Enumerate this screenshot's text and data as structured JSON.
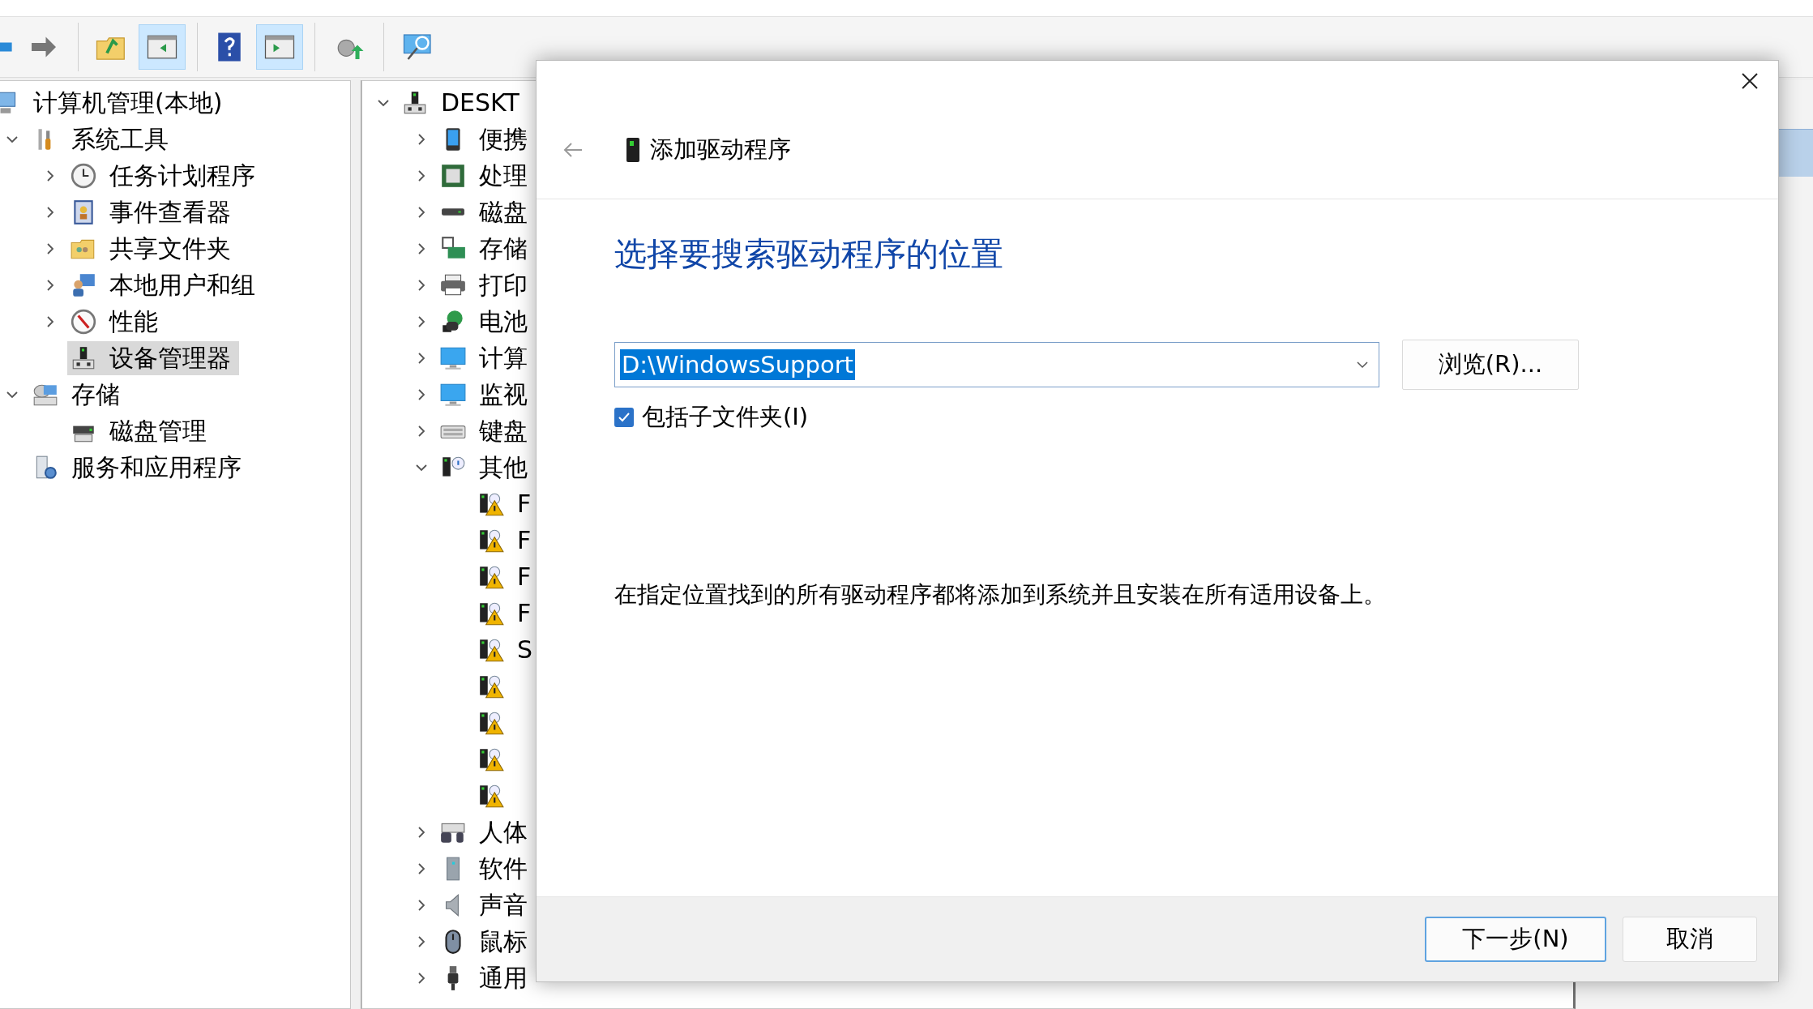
{
  "toolbar": {
    "buttons": [
      {
        "pressed": false
      },
      {
        "pressed": false
      },
      {
        "pressed": false
      },
      {
        "pressed": true
      },
      {
        "pressed": false
      },
      {
        "pressed": true
      },
      {
        "pressed": false
      },
      {
        "pressed": false
      }
    ]
  },
  "console_tree": {
    "items": [
      {
        "label": "计算机管理(本地)",
        "selected": false,
        "children": [
          {
            "label": "系统工具",
            "expanded": true,
            "selected": false,
            "children": [
              {
                "label": "任务计划程序",
                "expanded": false,
                "selected": false
              },
              {
                "label": "事件查看器",
                "expanded": false,
                "selected": false
              },
              {
                "label": "共享文件夹",
                "expanded": false,
                "selected": false
              },
              {
                "label": "本地用户和组",
                "expanded": false,
                "selected": false
              },
              {
                "label": "性能",
                "expanded": false,
                "selected": false
              },
              {
                "label": "设备管理器",
                "selected": true
              }
            ]
          },
          {
            "label": "存储",
            "expanded": true,
            "selected": false,
            "children": [
              {
                "label": "磁盘管理",
                "selected": false
              }
            ]
          },
          {
            "label": "服务和应用程序",
            "selected": false
          }
        ]
      }
    ]
  },
  "device_tree": {
    "items": [
      {
        "label": "DESKT",
        "expanded": true,
        "children": [
          {
            "label": "便携",
            "expanded": false
          },
          {
            "label": "处理",
            "expanded": false
          },
          {
            "label": "磁盘",
            "expanded": false
          },
          {
            "label": "存储",
            "expanded": false
          },
          {
            "label": "打印",
            "expanded": false
          },
          {
            "label": "电池",
            "expanded": false
          },
          {
            "label": "计算",
            "expanded": false
          },
          {
            "label": "监视",
            "expanded": false
          },
          {
            "label": "键盘",
            "expanded": false
          },
          {
            "label": "其他",
            "expanded": true,
            "children": [
              {
                "problem": true,
                "label": "F"
              },
              {
                "problem": true,
                "label": "F"
              },
              {
                "problem": true,
                "label": "F"
              },
              {
                "problem": true,
                "label": "F"
              },
              {
                "problem": true,
                "label": "S"
              },
              {
                "problem": true
              },
              {
                "problem": true
              },
              {
                "problem": true
              },
              {
                "problem": true
              }
            ]
          },
          {
            "label": "人体",
            "expanded": false
          },
          {
            "label": "软件",
            "expanded": false
          },
          {
            "label": "声音",
            "expanded": false
          },
          {
            "label": "鼠标",
            "expanded": false
          },
          {
            "label": "通用",
            "expanded": false
          }
        ]
      }
    ]
  },
  "dialog": {
    "title": "添加驱动程序",
    "heading": "选择要搜索驱动程序的位置",
    "location": {
      "value": "D:\\WindowsSupport",
      "text_selected": true
    },
    "browse_button": "浏览(R)...",
    "include_subfolders": {
      "label": "包括子文件夹(I)",
      "checked": true
    },
    "description": "在指定位置找到的所有驱动程序都将添加到系统并且安装在所有适用设备上。",
    "buttons": [
      {
        "label": "下一步(N)",
        "default": true
      },
      {
        "label": "取消",
        "default": false
      }
    ]
  }
}
